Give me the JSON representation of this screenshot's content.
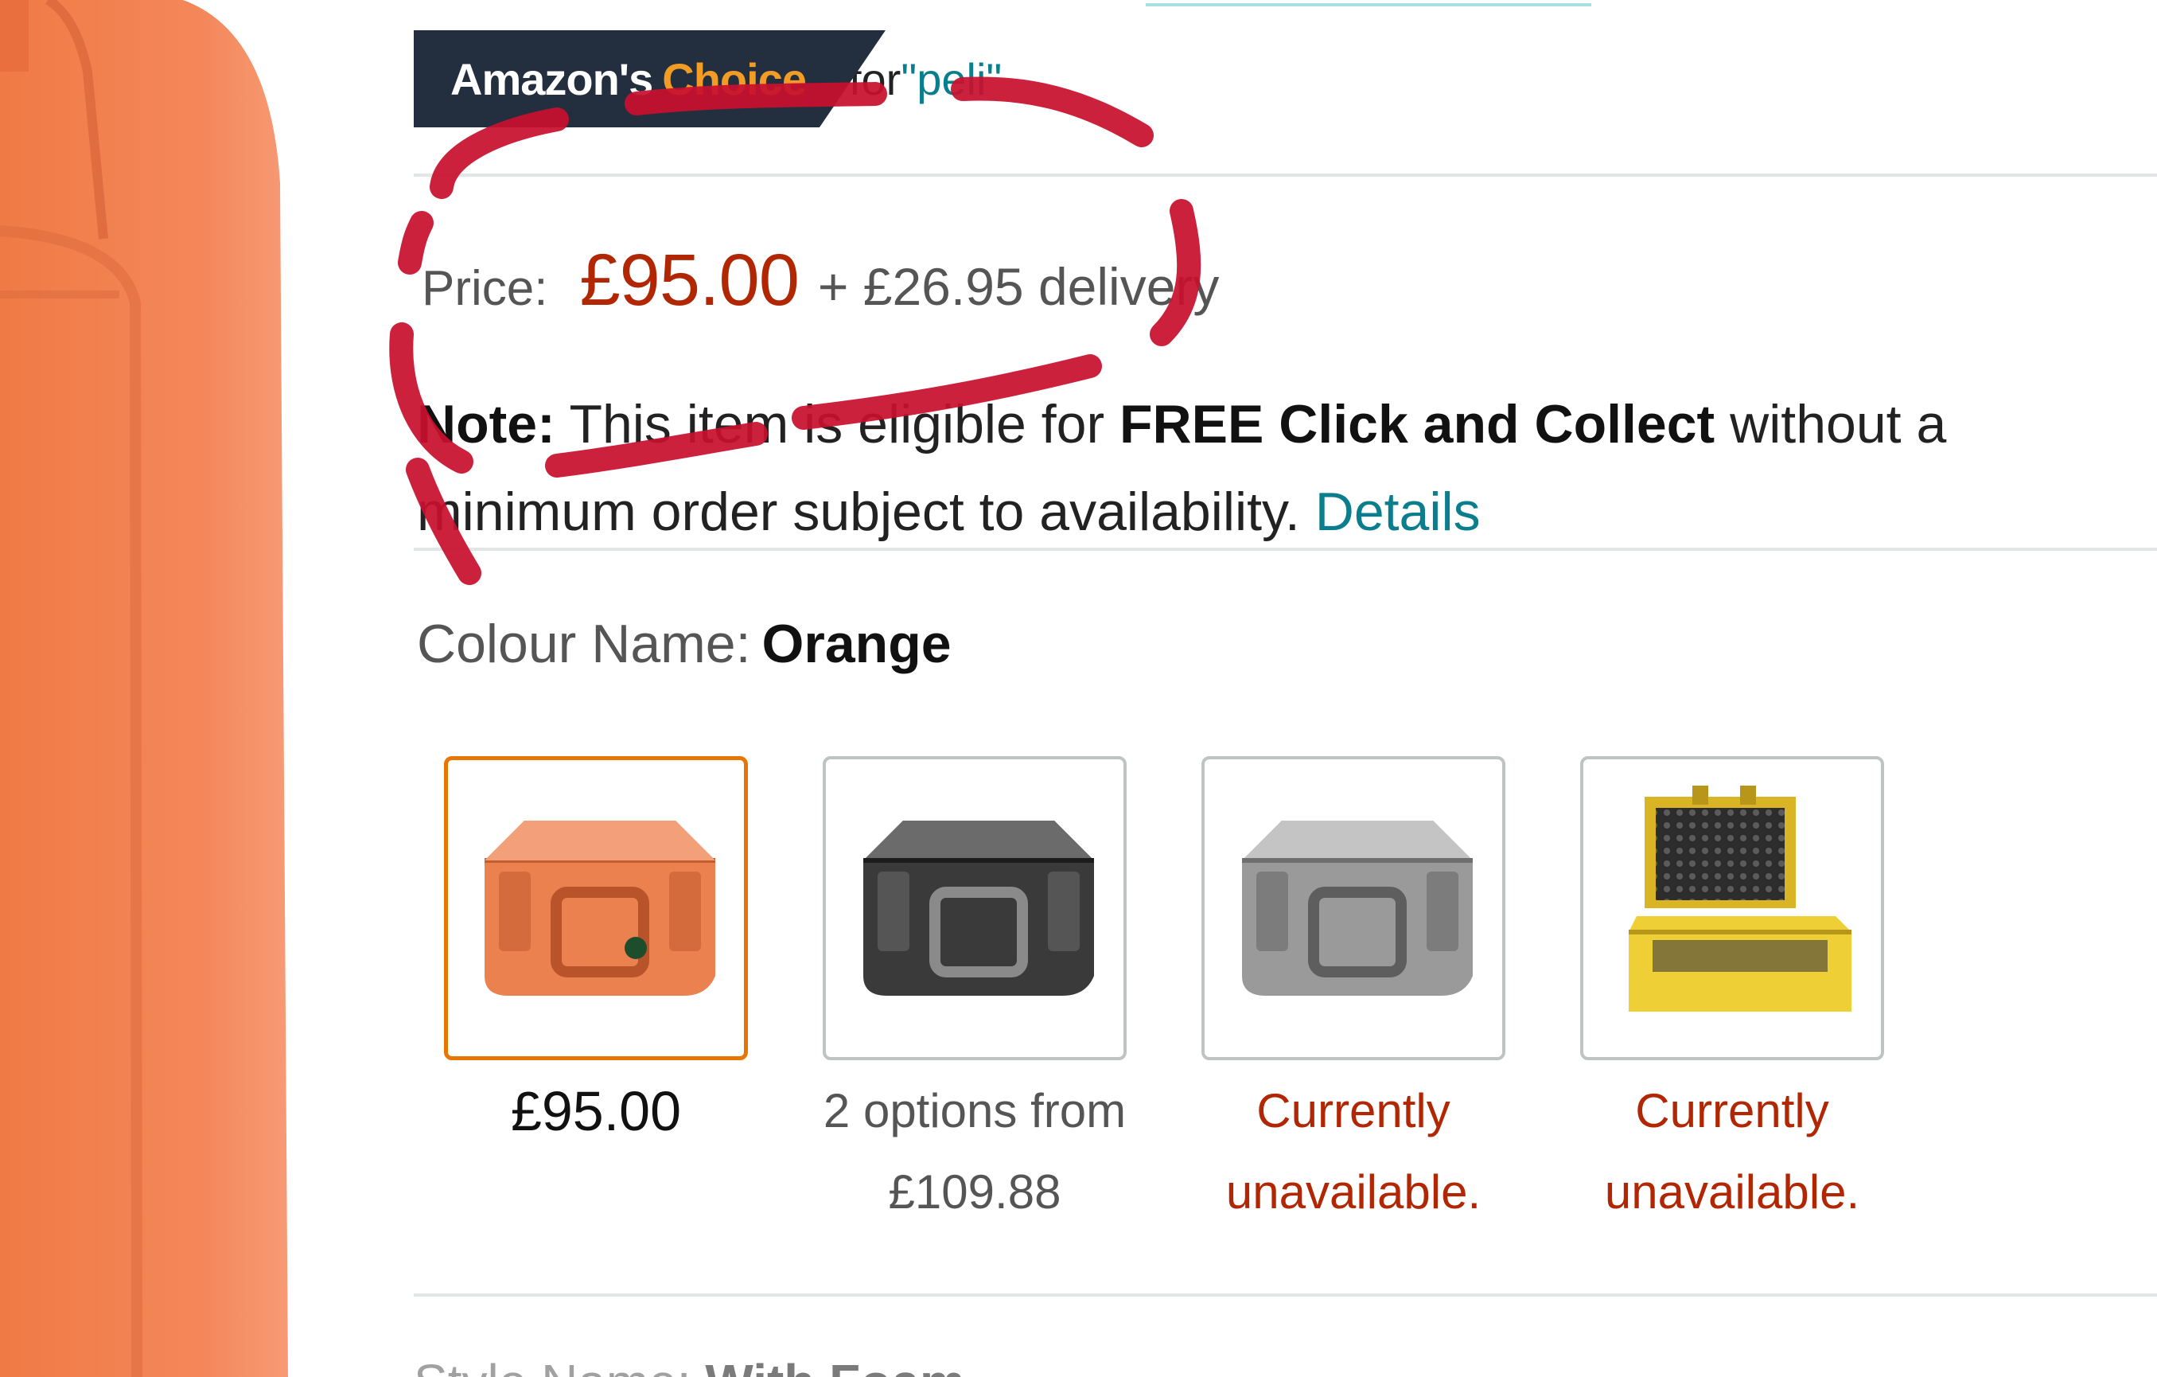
{
  "badge": {
    "title_start": "Amazon's",
    "title_accent": "Choice",
    "for_text": "for",
    "query": "\"peli\""
  },
  "price": {
    "label": "Price:",
    "value": "£95.00",
    "delivery": "+ £26.95 delivery"
  },
  "note": {
    "label": "Note:",
    "text_1": "This item is eligible for",
    "bold": "FREE Click and Collect",
    "text_2": "without a minimum order subject to availability.",
    "details_link": "Details"
  },
  "colour": {
    "label": "Colour Name:",
    "value": "Orange"
  },
  "swatches": [
    {
      "color_name": "orange",
      "caption_1": "£95.00",
      "caption_2": "",
      "selected": true
    },
    {
      "color_name": "black",
      "caption_1": "2 options from",
      "caption_2": "£109.88",
      "selected": false
    },
    {
      "color_name": "silver",
      "caption_1": "Currently",
      "caption_2": "unavailable.",
      "selected": false
    },
    {
      "color_name": "yellow",
      "caption_1": "Currently",
      "caption_2": "unavailable.",
      "selected": false
    }
  ],
  "colors": {
    "badge_bg": "#232f3e",
    "badge_accent": "#f39c25",
    "price": "#b12704",
    "link": "#0a7e8c",
    "selected_border": "#e77600",
    "annotation": "#c8102e"
  },
  "bottom": {
    "label": "Style Name:",
    "value": "With Foam"
  }
}
